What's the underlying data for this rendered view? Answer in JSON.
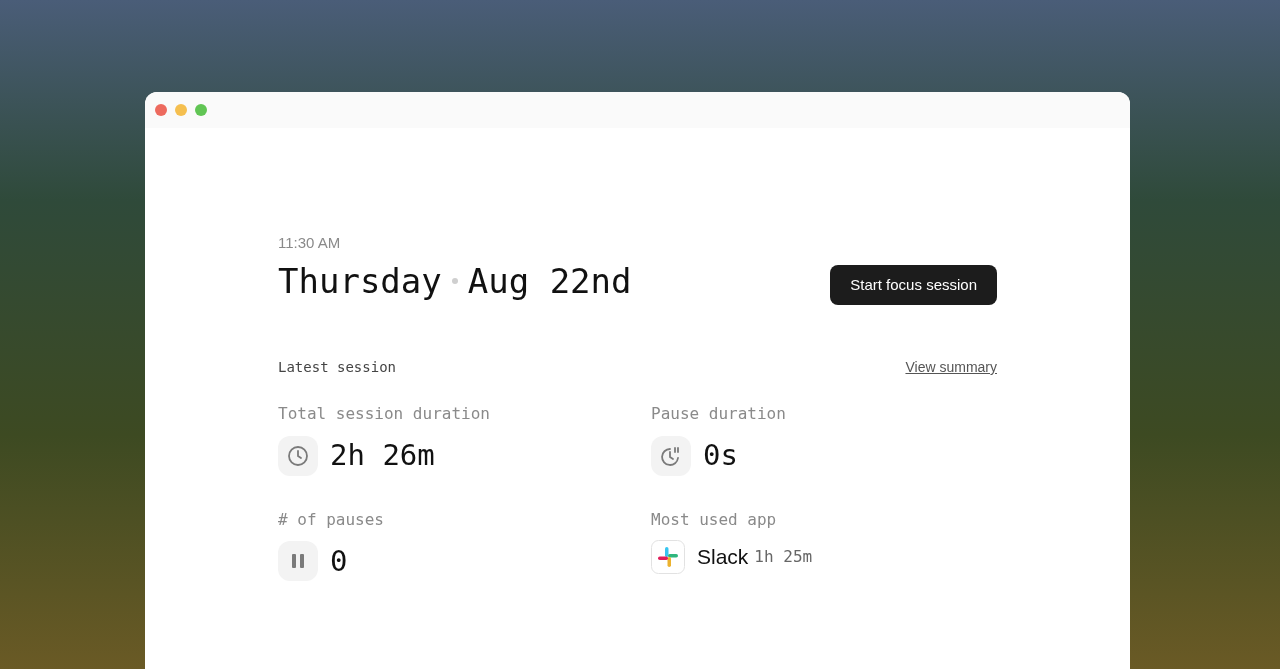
{
  "header": {
    "time": "11:30 AM",
    "day": "Thursday",
    "date": "Aug 22nd",
    "button": "Start focus session"
  },
  "session": {
    "title": "Latest session",
    "link": "View summary",
    "stats": [
      {
        "kind": "duration",
        "label": "Total session duration",
        "value": "2h 26m"
      },
      {
        "kind": "pause_duration",
        "label": "Pause duration",
        "value": "0s"
      },
      {
        "kind": "count",
        "label": "# of pauses",
        "value": "0"
      },
      {
        "kind": "app",
        "label": "Most used app",
        "value": "Slack",
        "detail": "1h 25m"
      }
    ]
  }
}
